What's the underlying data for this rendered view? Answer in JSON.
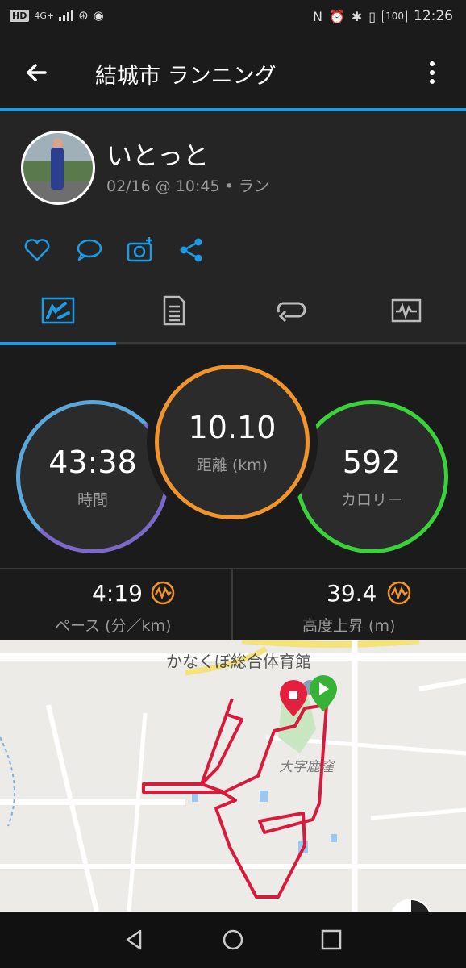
{
  "status_bar": {
    "hd": "HD",
    "network": "4G+",
    "battery": "100",
    "time": "12:26"
  },
  "app_bar": {
    "title": "結城市 ランニング"
  },
  "activity": {
    "user_name": "いとっと",
    "meta": "02/16 @ 10:45 • ラン"
  },
  "stats": {
    "time": {
      "value": "43:38",
      "label": "時間"
    },
    "distance": {
      "value": "10.10",
      "label": "距離 (km)"
    },
    "calories": {
      "value": "592",
      "label": "カロリー"
    }
  },
  "metrics": {
    "pace": {
      "value": "4:19",
      "label": "ペース (分／km)"
    },
    "elevation": {
      "value": "39.4",
      "label": "高度上昇 (m)"
    }
  },
  "map": {
    "place_label": "かなくぼ総合体育館",
    "area_label": "大字鹿窪"
  },
  "colors": {
    "accent": "#1e9be3",
    "time_ring": "#7b68c9",
    "distance_ring": "#f0952e",
    "calories_ring": "#3ad23a",
    "route": "#d81b3c",
    "metric_icon": "#f0952e"
  },
  "icons": {
    "back": "arrow-left-icon",
    "menu": "more-vertical-icon",
    "like": "heart-icon",
    "comment": "comment-icon",
    "photo": "add-photo-icon",
    "share": "share-icon",
    "tab_overview": "overview-tab-icon",
    "tab_details": "details-tab-icon",
    "tab_laps": "laps-tab-icon",
    "tab_charts": "charts-tab-icon"
  }
}
